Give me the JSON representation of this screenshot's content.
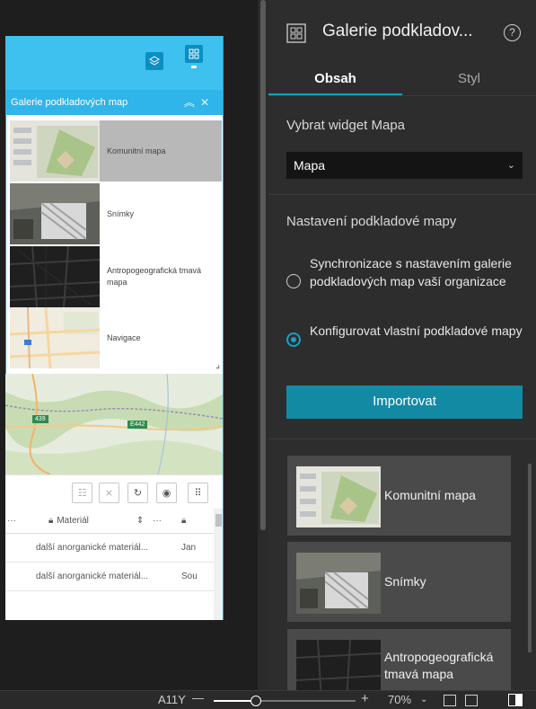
{
  "canvas": {
    "gallery_title": "Galerie podkladových map",
    "gallery_items": [
      {
        "label": "Komunitní mapa",
        "selected": true
      },
      {
        "label": "Snímky",
        "selected": false
      },
      {
        "label": "Antropogeografická tmavá mapa",
        "selected": false
      },
      {
        "label": "Navigace",
        "selected": false
      }
    ],
    "map_badges": {
      "road1": "439",
      "road2": "E442"
    },
    "table": {
      "header_more": "···",
      "column_material": "Materiál",
      "header_more2": "···",
      "rows": [
        {
          "material": "další anorganické materiál...",
          "next": "Jan"
        },
        {
          "material": "další anorganické materiál...",
          "next": "Sou"
        }
      ]
    }
  },
  "panel": {
    "title": "Galerie podkladov...",
    "tabs": [
      {
        "label": "Obsah",
        "active": true
      },
      {
        "label": "Styl",
        "active": false
      }
    ],
    "select_map_widget_label": "Vybrat widget Mapa",
    "map_select_value": "Mapa",
    "basemap_settings_label": "Nastavení podkladové mapy",
    "radio_options": [
      {
        "label": "Synchronizace s nastavením galerie podkladových map vaší organizace",
        "checked": false
      },
      {
        "label": "Konfigurovat vlastní podkladové mapy",
        "checked": true
      }
    ],
    "import_button": "Importovat",
    "cards": [
      {
        "label": "Komunitní mapa"
      },
      {
        "label": "Snímky"
      },
      {
        "label": "Antropogeografická tmavá mapa"
      }
    ]
  },
  "statusbar": {
    "page_label": "A11Y",
    "zoom_minus": "—",
    "zoom_plus": "+",
    "zoom_level": "70%",
    "zoom_fraction": 0.3
  },
  "colors": {
    "accent": "#14a1c8",
    "header_blue": "#3fc1f0",
    "import_button": "#138aa3"
  }
}
